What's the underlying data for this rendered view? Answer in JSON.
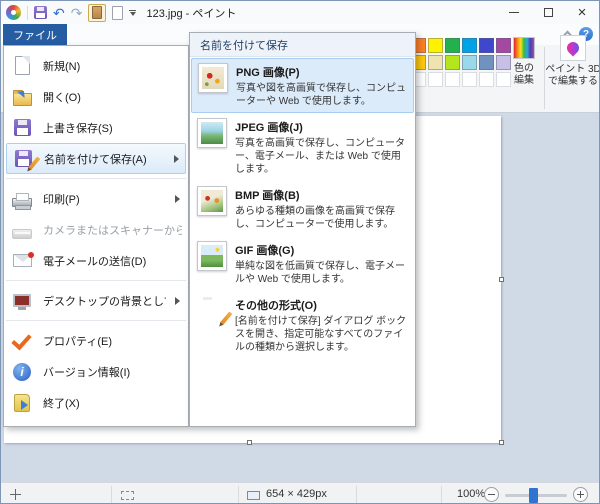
{
  "titlebar": {
    "title": "123.jpg - ペイント",
    "window_buttons": {
      "minimize": "minimize",
      "maximize": "maximize",
      "close": "×"
    }
  },
  "tabs": {
    "file": "ファイル"
  },
  "ribbon": {
    "edit_colors": "色の編集",
    "paint3d": "ペイント 3D で編集する",
    "help": "?",
    "palette_row1": [
      "#FF7F27",
      "#FFF200",
      "#22B14C",
      "#00A2E8",
      "#3F48CC",
      "#A349A4"
    ],
    "palette_row2": [
      "#FFC90E",
      "#EFE4B0",
      "#B5E61D",
      "#99D9EA",
      "#7092BE",
      "#C8BFE7"
    ]
  },
  "file_menu": {
    "new": "新規(N)",
    "open": "開く(O)",
    "save": "上書き保存(S)",
    "save_as": "名前を付けて保存(A)",
    "print": "印刷(P)",
    "from_scanner": "カメラまたはスキャナーから取り込み(M)",
    "send_email": "電子メールの送信(D)",
    "set_desktop": "デスクトップの背景として設定(B)",
    "properties": "プロパティ(E)",
    "about": "バージョン情報(I)",
    "exit": "終了(X)"
  },
  "save_as_menu": {
    "header": "名前を付けて保存",
    "png_title": "PNG 画像(P)",
    "png_desc": "写真や図を高画質で保存し、コンピューターや Web で使用します。",
    "jpeg_title": "JPEG 画像(J)",
    "jpeg_desc": "写真を高画質で保存し、コンピューター、電子メール、または Web で使用します。",
    "bmp_title": "BMP 画像(B)",
    "bmp_desc": "あらゆる種類の画像を高画質で保存し、コンピューターで使用します。",
    "gif_title": "GIF 画像(G)",
    "gif_desc": "単純な図を低画質で保存し、電子メールや Web で使用します。",
    "other_title": "その他の形式(O)",
    "other_desc": "[名前を付けて保存] ダイアログ ボックスを開き、指定可能なすべてのファイルの種類から選択します。"
  },
  "statusbar": {
    "image_size": "654 × 429px",
    "zoom": "100%"
  }
}
